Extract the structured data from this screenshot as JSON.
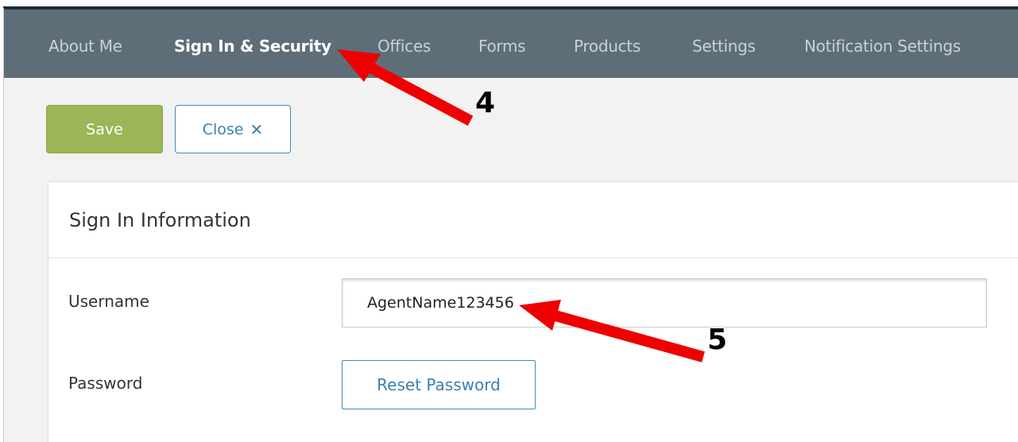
{
  "nav": {
    "items": [
      {
        "label": "About Me",
        "active": false
      },
      {
        "label": "Sign In & Security",
        "active": true
      },
      {
        "label": "Offices",
        "active": false
      },
      {
        "label": "Forms",
        "active": false
      },
      {
        "label": "Products",
        "active": false
      },
      {
        "label": "Settings",
        "active": false
      },
      {
        "label": "Notification Settings",
        "active": false
      }
    ]
  },
  "toolbar": {
    "save_label": "Save",
    "close_label": "Close",
    "close_icon": "✕"
  },
  "panel": {
    "title": "Sign In Information",
    "username_label": "Username",
    "username_value": "AgentName123456",
    "password_label": "Password",
    "reset_password_label": "Reset Password"
  },
  "annotations": {
    "marker_4": "4",
    "marker_5": "5"
  },
  "colors": {
    "nav_bg": "#5e6e78",
    "save_green": "#9cb556",
    "link_blue": "#3c7fb1",
    "arrow_red": "#ee0000"
  }
}
